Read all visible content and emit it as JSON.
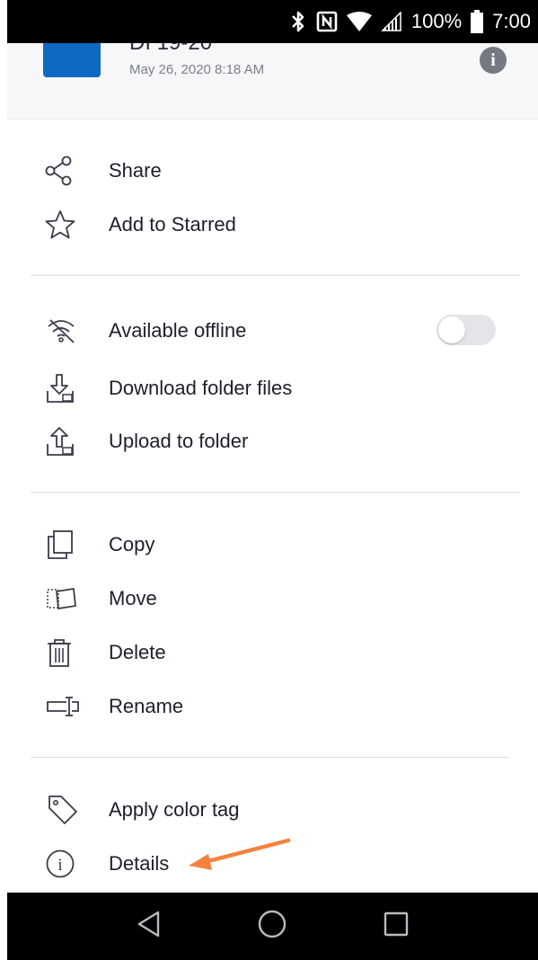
{
  "status_bar": {
    "battery": "100%",
    "time": "7:00"
  },
  "header": {
    "title": "DI 19-20",
    "date": "May 26, 2020 8:18 AM",
    "thumbnail_color": "#0d69c1"
  },
  "menu": {
    "share": "Share",
    "add_starred": "Add to Starred",
    "available_offline": "Available offline",
    "available_offline_enabled": false,
    "download_folder_files": "Download folder files",
    "upload_to_folder": "Upload to folder",
    "copy": "Copy",
    "move": "Move",
    "delete": "Delete",
    "rename": "Rename",
    "apply_color_tag": "Apply color tag",
    "details": "Details"
  },
  "annotation": {
    "arrow_color": "#f4823f",
    "arrow_target": "details"
  },
  "icons": [
    "share-icon",
    "star-icon",
    "offline-icon",
    "download-icon",
    "upload-icon",
    "copy-icon",
    "move-icon",
    "delete-icon",
    "rename-icon",
    "tag-icon",
    "info-icon",
    "bluetooth-icon",
    "nfc-icon",
    "wifi-icon",
    "signal-icon",
    "battery-icon",
    "back-icon",
    "home-icon",
    "recents-icon"
  ]
}
